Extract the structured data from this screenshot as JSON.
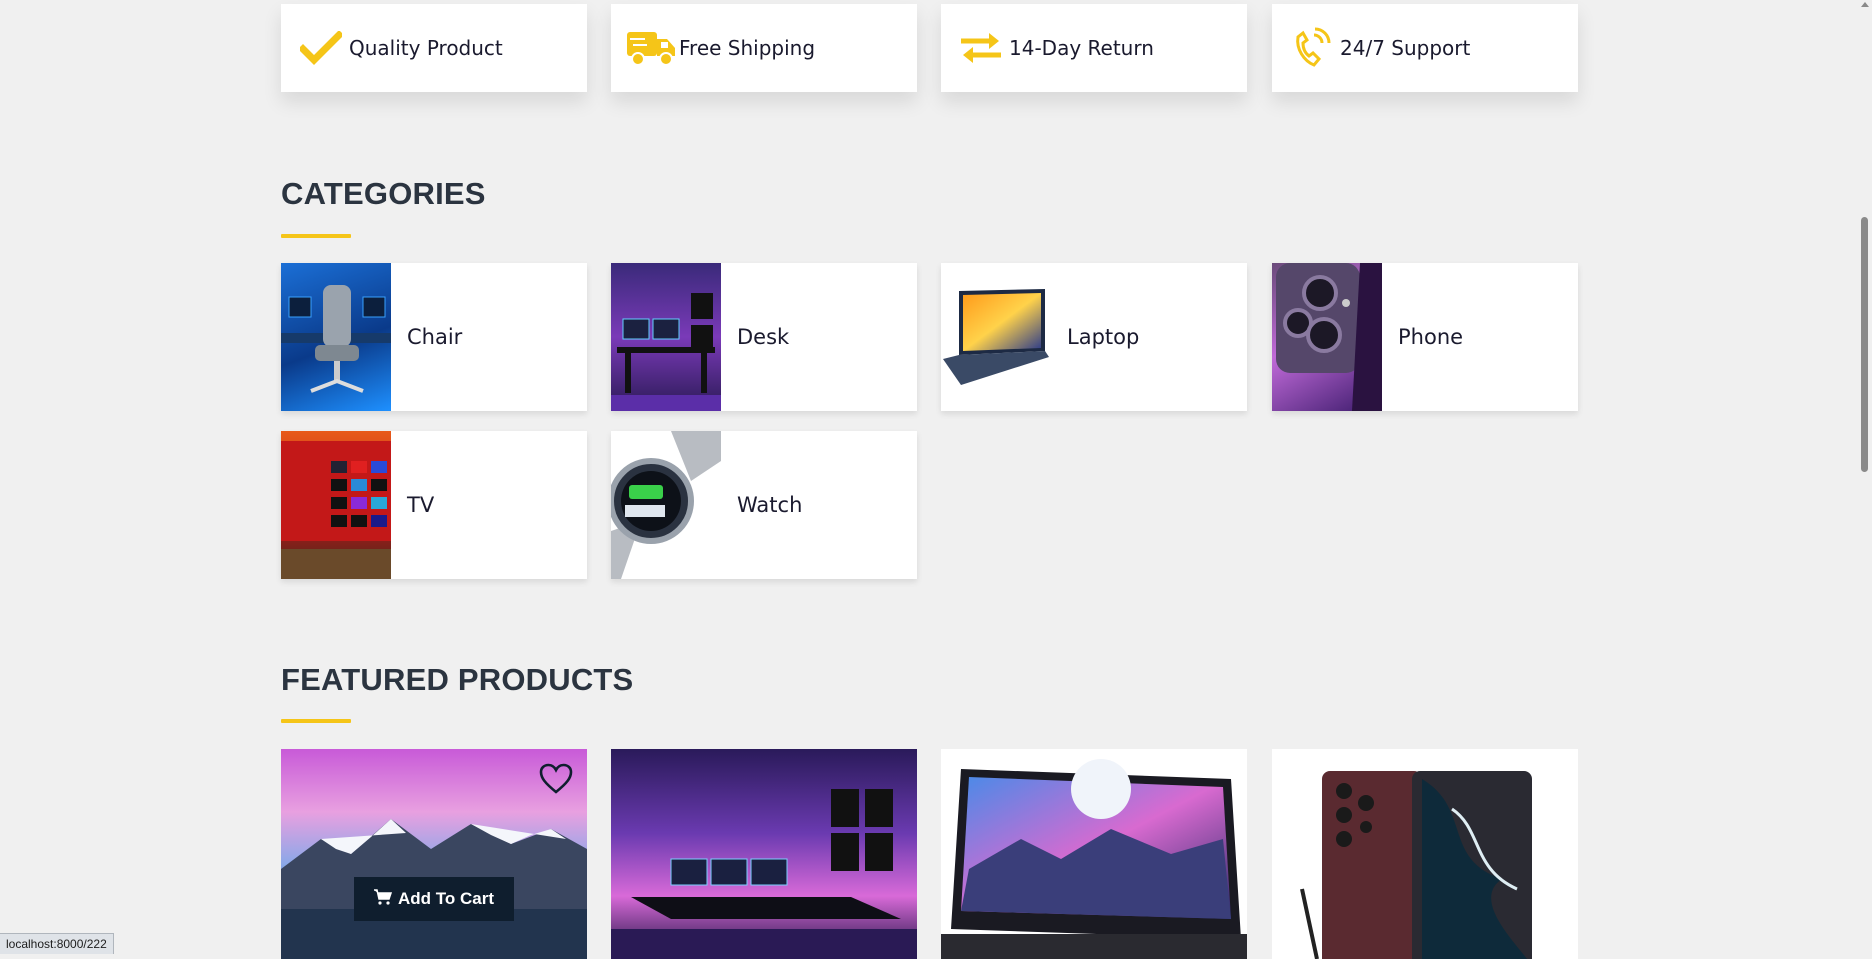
{
  "features": [
    {
      "label": "Quality Product",
      "icon": "check-icon"
    },
    {
      "label": "Free Shipping",
      "icon": "truck-icon"
    },
    {
      "label": "14-Day Return",
      "icon": "exchange-icon"
    },
    {
      "label": "24/7 Support",
      "icon": "phone-ringing-icon"
    }
  ],
  "categories_section": {
    "title": "CATEGORIES"
  },
  "categories": [
    {
      "name": "Chair"
    },
    {
      "name": "Desk"
    },
    {
      "name": "Laptop"
    },
    {
      "name": "Phone"
    },
    {
      "name": "TV"
    },
    {
      "name": "Watch"
    }
  ],
  "featured_section": {
    "title": "FEATURED PRODUCTS"
  },
  "products": [
    {
      "add_to_cart_label": "Add To Cart"
    }
  ],
  "status_bar": {
    "url": "localhost:8000/222"
  },
  "colors": {
    "accent": "#f5c518",
    "dark": "#0f1e2e",
    "heading": "#2b3440"
  }
}
